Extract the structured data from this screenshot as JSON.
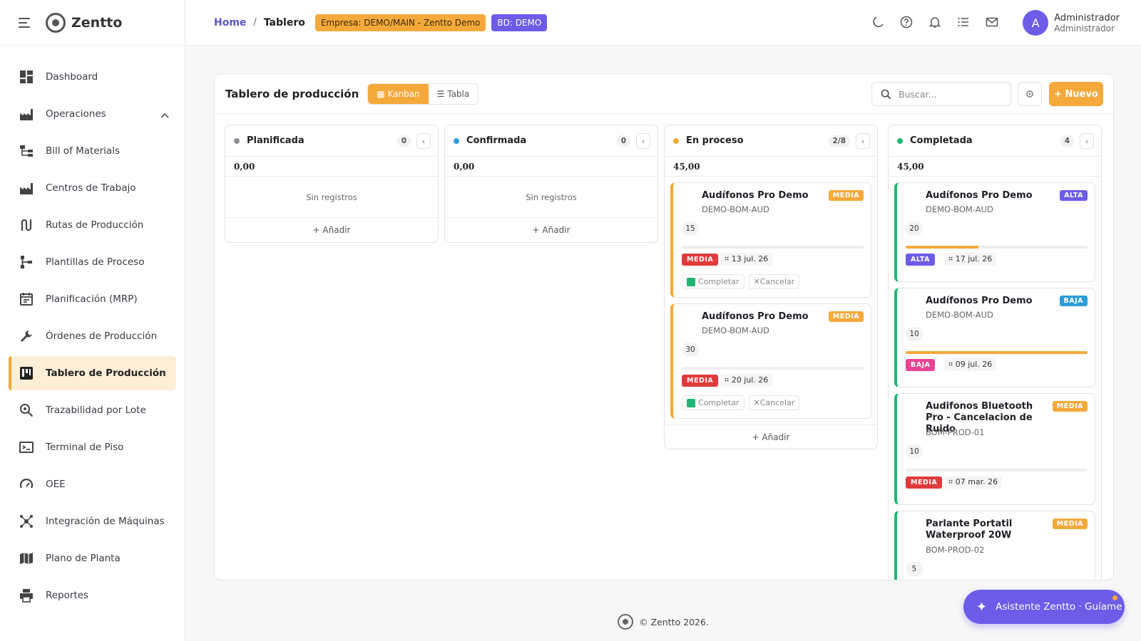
{
  "brand": {
    "name": "Zentto"
  },
  "sidebar": {
    "items": [
      {
        "label": "Dashboard",
        "icon": "dashboard-icon"
      },
      {
        "label": "Operaciones",
        "icon": "factory-icon",
        "expanded": true
      },
      {
        "label": "Bill of Materials",
        "icon": "hierarchy-icon"
      },
      {
        "label": "Centros de Trabajo",
        "icon": "factory-icon"
      },
      {
        "label": "Rutas de Producción",
        "icon": "route-icon"
      },
      {
        "label": "Plantillas de Proceso",
        "icon": "tree-icon"
      },
      {
        "label": "Planificación (MRP)",
        "icon": "calendar-icon"
      },
      {
        "label": "Órdenes de Producción",
        "icon": "wrench-icon"
      },
      {
        "label": "Tablero de Producción",
        "icon": "kanban-icon",
        "active": true
      },
      {
        "label": "Trazabilidad por Lote",
        "icon": "search-lot-icon"
      },
      {
        "label": "Terminal de Piso",
        "icon": "terminal-icon"
      },
      {
        "label": "OEE",
        "icon": "gauge-icon"
      },
      {
        "label": "Integración de Máquinas",
        "icon": "network-icon"
      },
      {
        "label": "Plano de Planta",
        "icon": "map-icon"
      },
      {
        "label": "Reportes",
        "icon": "printer-icon"
      }
    ]
  },
  "header": {
    "breadcrumb_home": "Home",
    "breadcrumb_sep": "/",
    "breadcrumb_current": "Tablero",
    "empresa_chip": "Empresa: DEMO/MAIN - Zentto Demo",
    "bd_chip": "BD: DEMO",
    "user_name": "Administrador",
    "user_role": "Administrador",
    "avatar_letter": "A"
  },
  "board": {
    "title": "Tablero de producción",
    "view_kanban": "Kanban",
    "view_table": "Tabla",
    "search_placeholder": "Buscar...",
    "new_label": "+ Nuevo",
    "add_label": "+ Añadir",
    "empty_label": "Sin registros",
    "complete_label": "Completar",
    "cancel_label": "Cancelar",
    "columns": [
      {
        "name": "Planificada",
        "count": "0",
        "total": "0,00",
        "color": "#8e8e99"
      },
      {
        "name": "Confirmada",
        "count": "0",
        "total": "0,00",
        "color": "#2d9cdb"
      },
      {
        "name": "En proceso",
        "count": "2/8",
        "total": "45,00",
        "color": "#f5a93b"
      },
      {
        "name": "Completada",
        "count": "4",
        "total": "45,00",
        "color": "#21b573"
      }
    ],
    "in_process_cards": [
      {
        "title": "Audífonos Pro Demo",
        "code": "DEMO-BOM-AUD",
        "priority": "MEDIA",
        "qty": "15",
        "tag": "MEDIA",
        "date": "13 jul. 26"
      },
      {
        "title": "Audífonos Pro Demo",
        "code": "DEMO-BOM-AUD",
        "priority": "MEDIA",
        "qty": "30",
        "tag": "MEDIA",
        "date": "20 jul. 26"
      }
    ],
    "completed_cards": [
      {
        "title": "Audífonos Pro Demo",
        "code": "DEMO-BOM-AUD",
        "priority": "ALTA",
        "qty": "20",
        "tag": "ALTA",
        "date": "17 jul. 26",
        "progress": 0.4
      },
      {
        "title": "Audífonos Pro Demo",
        "code": "DEMO-BOM-AUD",
        "priority": "BAJA",
        "qty": "10",
        "tag": "BAJA",
        "date": "09 jul. 26",
        "progress": 1.0
      },
      {
        "title": "Audifonos Bluetooth Pro - Cancelacion de Ruido",
        "code": "BOM-PROD-01",
        "priority": "MEDIA",
        "qty": "10",
        "tag": "MEDIA",
        "date": "07 mar. 26",
        "progress": 0
      },
      {
        "title": "Parlante Portatil Waterproof 20W",
        "code": "BOM-PROD-02",
        "priority": "MEDIA",
        "qty": "5"
      }
    ]
  },
  "colors": {
    "accent": "#f5a93b",
    "primary": "#6c5ce7",
    "alta": "#6c5ce7",
    "baja_badge": "#2d9cdb",
    "baja_tag": "#e84393",
    "media_tag": "#e03b3b",
    "success": "#21b573"
  },
  "footer": {
    "copyright": "© Zentto 2026."
  },
  "assistant": {
    "label": "Asistente Zentto · Guíame"
  }
}
